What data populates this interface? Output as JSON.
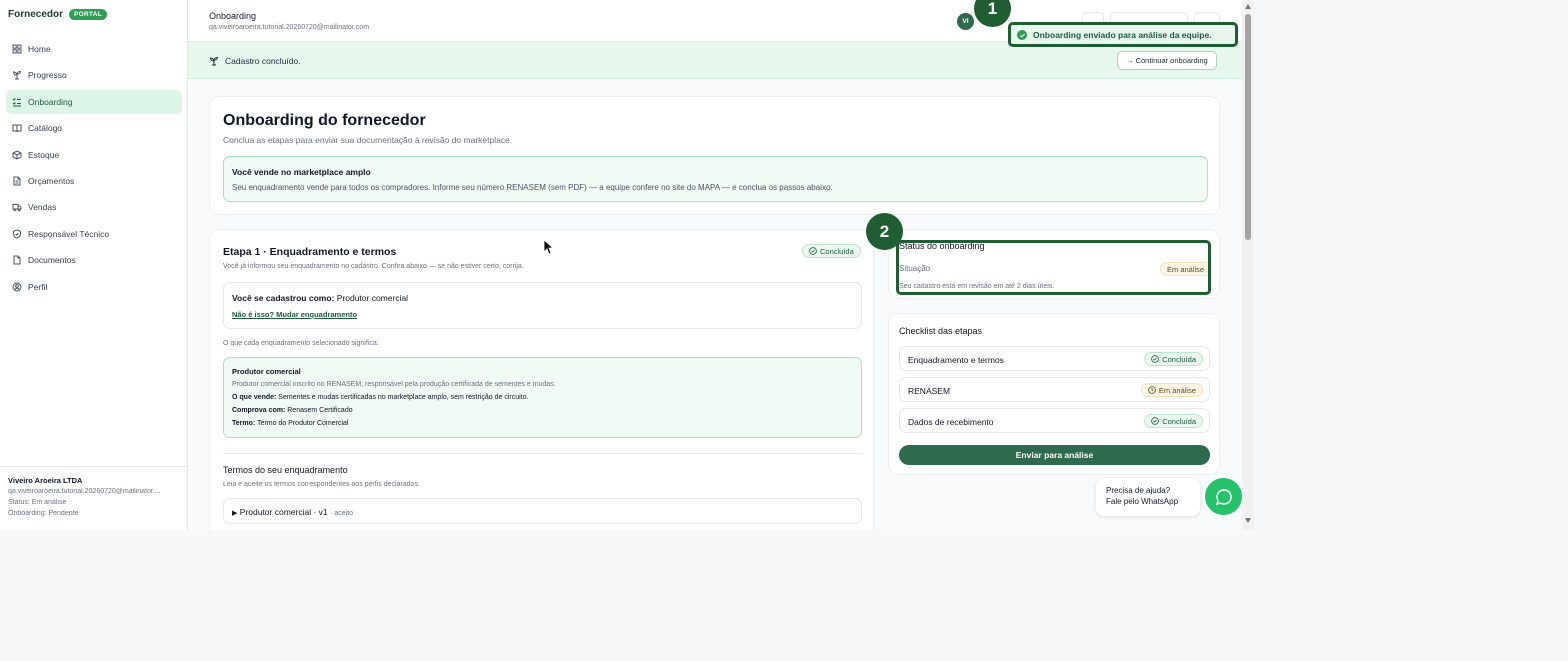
{
  "brand": {
    "name": "Fornecedor",
    "badge": "PORTAL"
  },
  "sidebar": {
    "items": [
      {
        "label": "Home",
        "icon": "grid-icon"
      },
      {
        "label": "Progresso",
        "icon": "sprout-icon"
      },
      {
        "label": "Onboarding",
        "icon": "checklist-icon",
        "active": true
      },
      {
        "label": "Catálogo",
        "icon": "book-icon"
      },
      {
        "label": "Estoque",
        "icon": "box-icon"
      },
      {
        "label": "Orçamentos",
        "icon": "document-icon"
      },
      {
        "label": "Vendas",
        "icon": "truck-icon"
      },
      {
        "label": "Responsável Técnico",
        "icon": "shield-icon"
      },
      {
        "label": "Documentos",
        "icon": "file-icon"
      },
      {
        "label": "Perfil",
        "icon": "user-icon"
      }
    ],
    "footer": {
      "company": "Viveiro Aroeira LTDA",
      "email": "qa.viveiroaroeira.tutorial.20260720@mailinator....",
      "status": "Status: Em análise",
      "onboarding": "Onboarding: Pendente"
    }
  },
  "header": {
    "title": "Onboarding",
    "email": "qa.viveiroaroeira.tutorial.20260720@mailinator.com",
    "avatar": "VI"
  },
  "banner": {
    "text": "Cadastro concluído.",
    "button": "→ Continuar onboarding"
  },
  "hero": {
    "title": "Onboarding do fornecedor",
    "subtitle": "Conclua as etapas para enviar sua documentação à revisão do marketplace.",
    "box_title": "Você vende no marketplace amplo",
    "box_text": "Seu enquadramento vende para todos os compradores. Informe seu número RENASEM (sem PDF) — a equipe confere no site do MAPA — e conclua os passos abaixo."
  },
  "step1": {
    "title": "Etapa 1 · Enquadramento e termos",
    "status": "Concluída",
    "subtitle": "Você já informou seu enquadramento no cadastro. Confira abaixo — se não estiver certo, corrija.",
    "registered_label": "Você se cadastrou como:",
    "registered_value": "Produtor comercial",
    "change_link": "Não é isso? Mudar enquadramento",
    "meaning_label": "O que cada enquadramento selecionado significa:",
    "meaning": {
      "title": "Produtor comercial",
      "description": "Produtor comercial inscrito no RENASEM, responsável pela produção certificada de sementes e mudas.",
      "sells_label": "O que vende:",
      "sells_value": "Sementes e mudas certificadas no marketplace amplo, sem restrição de circuito.",
      "proves_label": "Comprova com:",
      "proves_value": "Renasem Certificado",
      "term_label": "Termo:",
      "term_value": "Termo do Produtor Comercial"
    },
    "terms_title": "Termos do seu enquadramento",
    "terms_subtitle": "Leia e aceite os termos correspondentes aos perfis declarados.",
    "term_item": "Produtor comercial · v1",
    "term_item_status": "· aceito"
  },
  "status_card": {
    "title": "Status do onboarding",
    "label": "Situação",
    "value": "Em análise",
    "text": "Seu cadastro está em revisão em até 2 dias úteis."
  },
  "checklist": {
    "title": "Checklist das etapas",
    "rows": [
      {
        "label": "Enquadramento e termos",
        "status": "Concluída",
        "kind": "ok"
      },
      {
        "label": "RENASEM",
        "status": "Em análise",
        "kind": "wait"
      },
      {
        "label": "Dados de recebimento",
        "status": "Concluída",
        "kind": "ok"
      }
    ],
    "submit": "Enviar para análise"
  },
  "toast": {
    "text": "Onboarding enviado para análise da equipe."
  },
  "markers": [
    "1",
    "2"
  ],
  "whatsapp": {
    "line1": "Precisa de ajuda?",
    "line2": "Fale pelo WhatsApp"
  },
  "colors": {
    "primary": "#2e6a4e",
    "accent": "#2f9e55",
    "marker": "#1f5e32",
    "success_bg": "#effbf4",
    "warning_bg": "#fff7e6"
  }
}
